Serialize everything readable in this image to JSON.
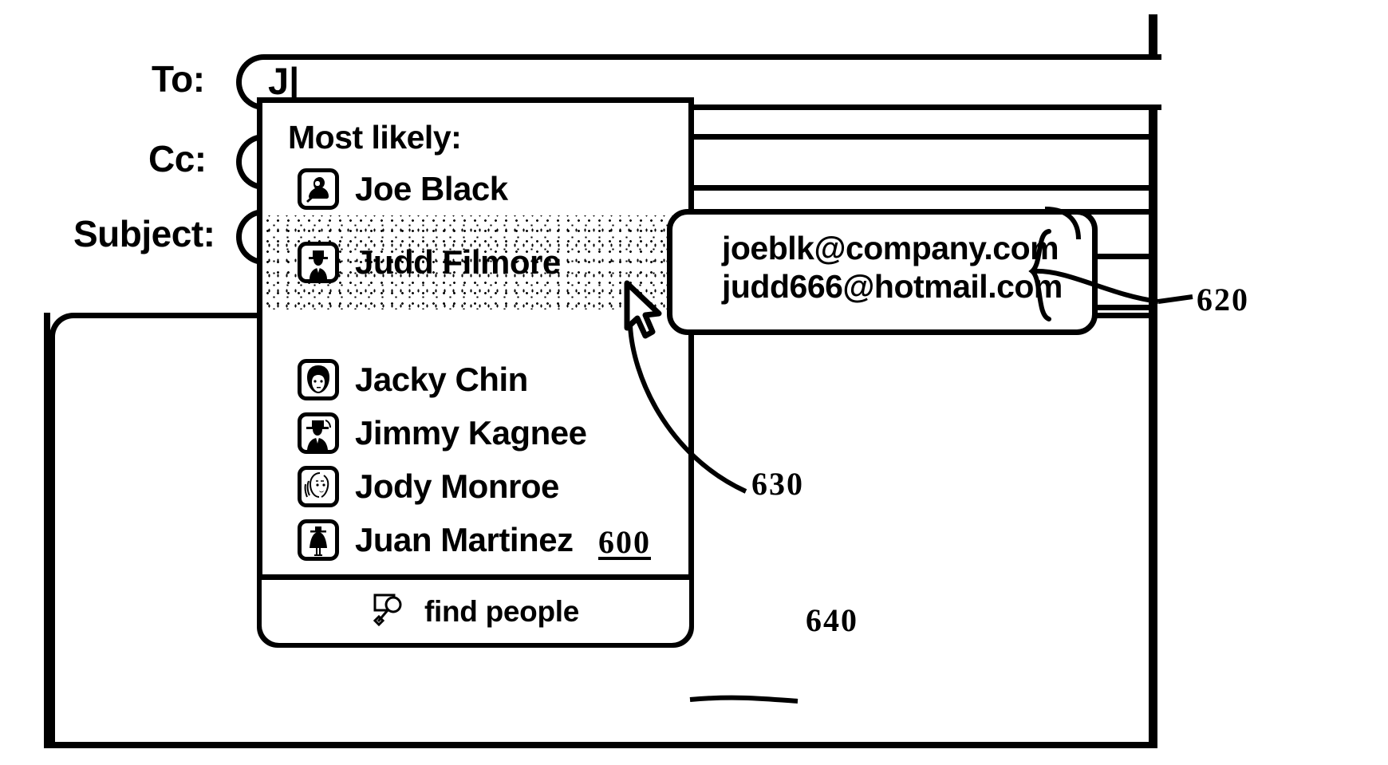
{
  "figure": {
    "type": "patent-drawing",
    "description": "Email compose window with recipient autocomplete dropdown"
  },
  "compose": {
    "fields": [
      {
        "label": "To:",
        "value": "J",
        "caret": "|"
      },
      {
        "label": "Cc:",
        "value": ""
      },
      {
        "label": "Subject:",
        "value": ""
      }
    ],
    "to_label": "To:",
    "cc_label": "Cc:",
    "subject_label": "Subject:",
    "to_value": "J",
    "caret": "|"
  },
  "dropdown": {
    "header": "Most likely:",
    "items": [
      {
        "name": "Joe Black",
        "icon": "person-hood-icon",
        "selected": false
      },
      {
        "name": "Judd Filmore",
        "icon": "person-hat-suit-icon",
        "selected": true
      },
      {
        "name": "Jacky Chin",
        "icon": "person-bobhair-icon",
        "selected": false
      },
      {
        "name": "Jimmy Kagnee",
        "icon": "person-fedora-icon",
        "selected": false
      },
      {
        "name": "Jody Monroe",
        "icon": "person-woman-icon",
        "selected": false
      },
      {
        "name": "Juan Martinez",
        "icon": "person-poncho-icon",
        "selected": false
      }
    ],
    "footer": {
      "label": "find people",
      "icon": "find-people-magnifier-icon"
    }
  },
  "tooltip": {
    "emails": [
      "joeblk@company.com",
      "judd666@hotmail.com"
    ]
  },
  "cursor": {
    "icon": "mouse-pointer-icon"
  },
  "reference_numerals": [
    {
      "id": "600",
      "underlined": true,
      "points_to": "autocomplete-dropdown"
    },
    {
      "id": "620",
      "underlined": false,
      "points_to": "email-address-tooltip"
    },
    {
      "id": "630",
      "underlined": false,
      "points_to": "mouse-cursor"
    },
    {
      "id": "640",
      "underlined": false,
      "points_to": "find-people-row"
    }
  ],
  "colors": {
    "ink": "#000000",
    "paper": "#ffffff"
  }
}
